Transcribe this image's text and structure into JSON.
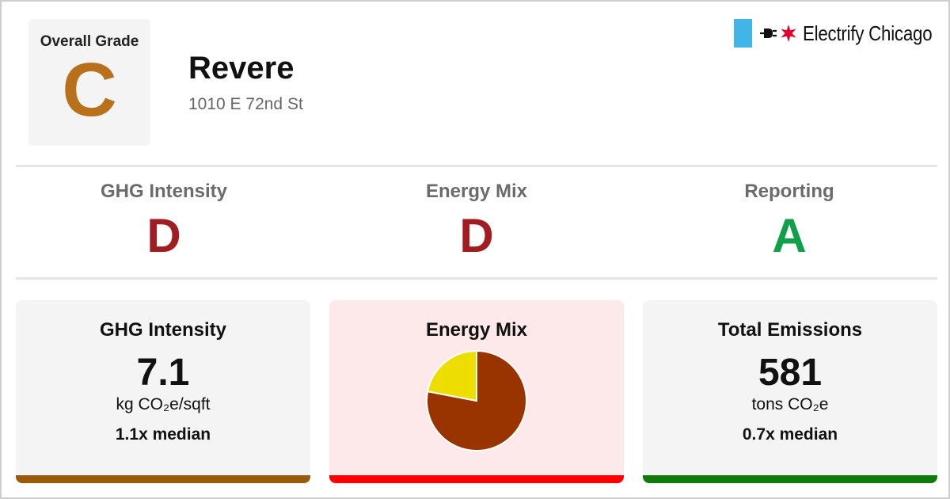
{
  "header": {
    "overall_grade_label": "Overall Grade",
    "overall_grade": "C",
    "overall_grade_color": "#b8701a",
    "building_name": "Revere",
    "building_address": "1010 E 72nd St"
  },
  "brand": {
    "name": "Electrify Chicago",
    "flag_color": "#41b6e6",
    "star_color": "#e4002b",
    "icons": [
      "flag-icon",
      "plug-icon",
      "star-icon"
    ]
  },
  "subgrades": [
    {
      "title": "GHG Intensity",
      "grade": "D",
      "color": "#a11d22"
    },
    {
      "title": "Energy Mix",
      "grade": "D",
      "color": "#a11d22"
    },
    {
      "title": "Reporting",
      "grade": "A",
      "color": "#11a04a"
    }
  ],
  "cards": {
    "ghg": {
      "title": "GHG Intensity",
      "value": "7.1",
      "unit": "kg CO₂e/sqft",
      "median": "1.1x median",
      "bar_color": "#9a5a0c",
      "bg_color": "#f4f4f4"
    },
    "energy_mix": {
      "title": "Energy Mix",
      "bar_color": "#ff0000",
      "bg_color": "#fde8ea"
    },
    "emissions": {
      "title": "Total Emissions",
      "value": "581",
      "unit": "tons CO₂e",
      "median": "0.7x median",
      "bar_color": "#117a0d",
      "bg_color": "#f4f4f4"
    }
  },
  "chart_data": {
    "type": "pie",
    "slices": [
      {
        "value": 78,
        "color": "#993300"
      },
      {
        "value": 22,
        "color": "#eedd00"
      }
    ]
  }
}
